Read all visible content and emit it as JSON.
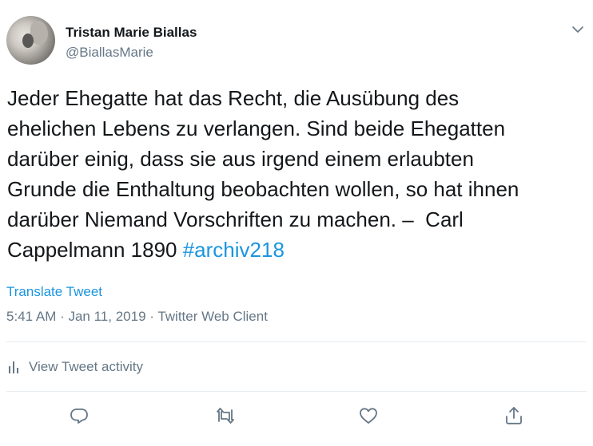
{
  "user": {
    "display_name": "Tristan Marie Biallas",
    "handle": "@BiallasMarie"
  },
  "tweet": {
    "text": "Jeder Ehegatte hat das Recht, die Ausübung des\nehelichen Lebens zu verlangen. Sind beide Ehegatten\ndarüber einig, dass sie aus irgend einem erlaubten\nGrunde die Enthaltung beobachten wollen, so hat ihnen\ndarüber Niemand Vorschriften zu machen. –  Carl\nCappelmann 1890 ",
    "hashtag": "#archiv218",
    "translate_label": "Translate Tweet",
    "meta": "5:41 AM · Jan 11, 2019 · Twitter Web Client"
  },
  "activity": {
    "label": "View Tweet activity"
  },
  "icons": {
    "caret": "chevron-down-icon",
    "reply": "reply-icon",
    "retweet": "retweet-icon",
    "like": "heart-icon",
    "share": "share-icon",
    "activity": "bar-chart-icon"
  },
  "colors": {
    "link": "#1b95e0",
    "secondary": "#657786",
    "text": "#14171a"
  }
}
